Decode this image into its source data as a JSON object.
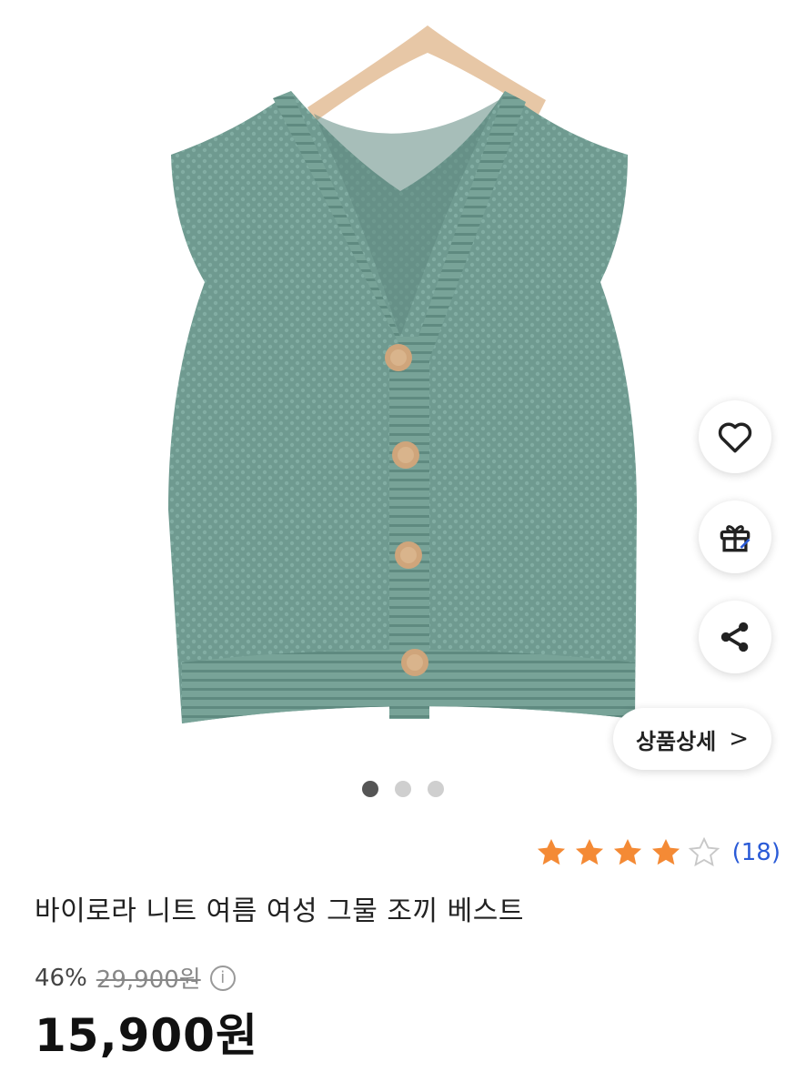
{
  "product": {
    "name": "바이로라 니트 여름 여성 그물 조끼 베스트",
    "image_alt": "green knit vest with wooden buttons on hanger",
    "rating_value": 4,
    "rating_max": 5,
    "review_count": "(18)",
    "discount": "46%",
    "original_price": "29,900원",
    "sale_price": "15,900원"
  },
  "actions": {
    "favorite_icon": "heart-icon",
    "gift_icon": "gift-icon",
    "share_icon": "share-icon",
    "detail_label": "상품상세",
    "detail_chevron": ">"
  },
  "carousel": {
    "total": 3,
    "active_index": 0
  },
  "colors": {
    "star_filled": "#f48a35",
    "link": "#2a5bd7",
    "vest": "#6f9a90",
    "hanger": "#e7c7a6"
  }
}
